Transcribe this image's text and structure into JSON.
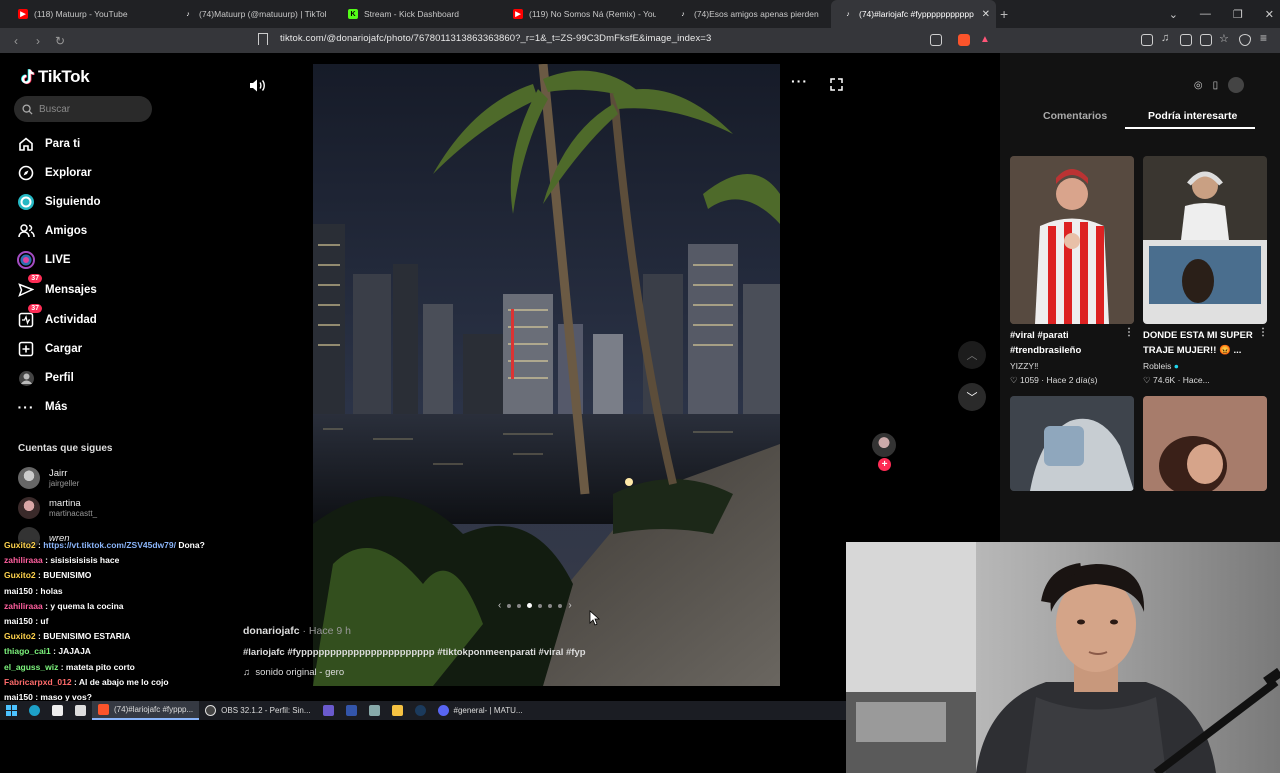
{
  "browser": {
    "tabs": [
      {
        "title": "(118) Matuurp - YouTube",
        "icon": "youtube-icon",
        "color": "#ff0000"
      },
      {
        "title": "(74)Matuurp (@matuuurp) | TikTok",
        "icon": "tiktok-icon",
        "color": "#ffffff"
      },
      {
        "title": "Stream - Kick Dashboard",
        "icon": "kick-icon",
        "color": "#53fc18"
      },
      {
        "title": "(119) No Somos Ná (Remix) - YouTube",
        "icon": "youtube-icon",
        "color": "#ff0000"
      },
      {
        "title": "(74)Esos amigos apenas pierden la pa",
        "icon": "tiktok-icon",
        "color": "#ffffff"
      },
      {
        "title": "(74)#lariojafc #fyppppppppppp",
        "icon": "tiktok-icon",
        "color": "#ffffff",
        "active": true
      }
    ],
    "url": "tiktok.com/@donariojafc/photo/7678011313863363860?_r=1&_t=ZS-99C3DmFksfE&image_index=3"
  },
  "sidebar": {
    "logo": "TikTok",
    "search_placeholder": "Buscar",
    "nav": [
      {
        "label": "Para ti",
        "icon": "home-icon"
      },
      {
        "label": "Explorar",
        "icon": "compass-icon"
      },
      {
        "label": "Siguiendo",
        "icon": "following-icon"
      },
      {
        "label": "Amigos",
        "icon": "friends-icon"
      },
      {
        "label": "LIVE",
        "icon": "live-icon"
      },
      {
        "label": "Mensajes",
        "icon": "messages-icon",
        "badge": "37"
      },
      {
        "label": "Actividad",
        "icon": "activity-icon",
        "badge": "37"
      },
      {
        "label": "Cargar",
        "icon": "upload-icon"
      },
      {
        "label": "Perfil",
        "icon": "profile-icon"
      },
      {
        "label": "Más",
        "icon": "more-icon"
      }
    ],
    "following_title": "Cuentas que sigues",
    "accounts": [
      {
        "name": "Jairr",
        "username": "jairgeller"
      },
      {
        "name": "martina",
        "username": "martinacastt_"
      },
      {
        "name": "wren",
        "username": ""
      }
    ]
  },
  "chat": [
    {
      "user": "Guxito2",
      "color": "#ffd34d",
      "msg": "https://vt.tiktok.com/ZSV45dw79/",
      "msg_color": "#8ab4f8",
      "extra": " Dona?"
    },
    {
      "user": "zahiliraaa",
      "color": "#ff5f9e",
      "msg": "sisisisisisis hace"
    },
    {
      "user": "Guxito2",
      "color": "#ffd34d",
      "msg": "BUENISIMO"
    },
    {
      "user": "mai150",
      "color": "#ffffff",
      "msg": "holas"
    },
    {
      "user": "zahiliraaa",
      "color": "#ff5f9e",
      "msg": "y quema la cocina"
    },
    {
      "user": "mai150",
      "color": "#ffffff",
      "msg": "uf"
    },
    {
      "user": "Guxito2",
      "color": "#ffd34d",
      "msg": "BUENISIMO ESTARIA"
    },
    {
      "user": "thiago_cai1",
      "color": "#7cf27c",
      "msg": "JAJAJA"
    },
    {
      "user": "el_aguss_wiz",
      "color": "#7cf27c",
      "msg": "mateta pito corto"
    },
    {
      "user": "Fabricarpxd_012",
      "color": "#ff6b6b",
      "msg": "Al de abajo me lo cojo"
    },
    {
      "user": "mai150",
      "color": "#ffffff",
      "msg": "maso y vos?"
    }
  ],
  "post": {
    "username": "donariojafc",
    "time": " · Hace 9 h",
    "caption": "#lariojafc #fyppppppppppppppppppppppp #tiktokponmeenparati #viral #fyp",
    "sound": "sonido original - gero",
    "dots_total": 6,
    "dots_active": 3
  },
  "rightpanel": {
    "tabs": [
      "Comentarios",
      "Podría interesarte"
    ],
    "cards": [
      {
        "title": "#viral #parati #trendbrasileño",
        "author": "YIZZY‼",
        "likes": "1059",
        "time": "Hace 2 día(s)"
      },
      {
        "title": "DONDE ESTA MI SUPER TRAJE MUJER!! 😡 ...",
        "author": "Robleis",
        "likes": "74.6K",
        "time": "Hace..."
      }
    ]
  },
  "taskbar": [
    {
      "label": "(74)#lariojafc #fyppp...",
      "active": true
    },
    {
      "label": "OBS 32.1.2 - Perfil: Sin..."
    },
    {
      "label": "#general- | MATU..."
    }
  ],
  "colors": {
    "accent": "#fe2c55",
    "bg": "#000000",
    "panel": "#121212"
  }
}
